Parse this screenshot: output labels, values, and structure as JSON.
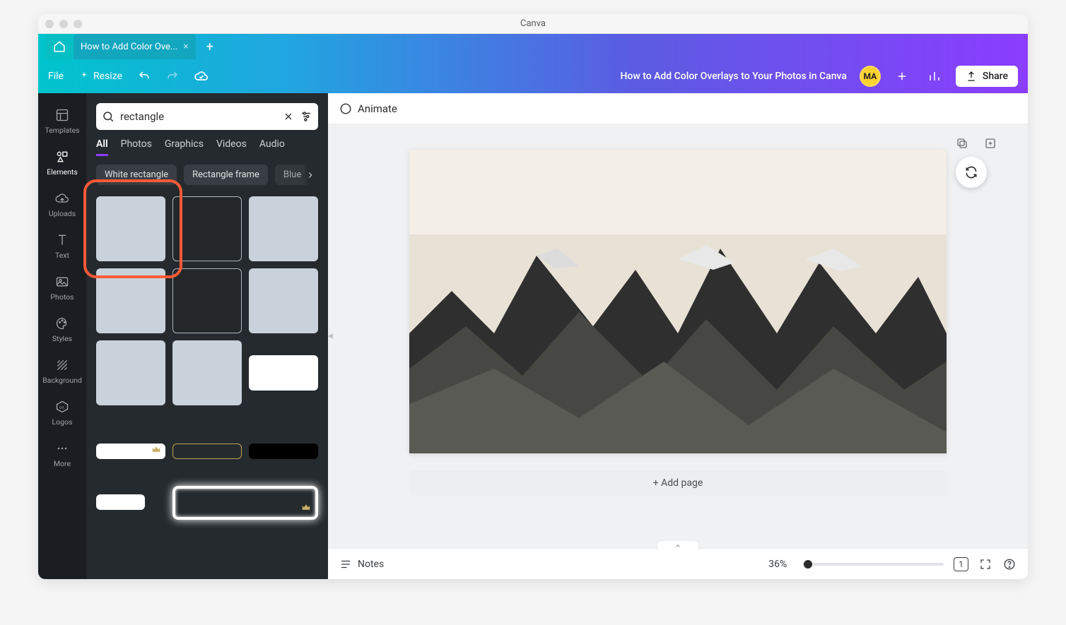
{
  "app_title": "Canva",
  "tabs": {
    "doc_label": "How to Add Color Ove..."
  },
  "toolbar": {
    "file": "File",
    "resize": "Resize",
    "doc_title": "How to Add Color Overlays to Your Photos in Canva",
    "avatar_initials": "MA",
    "share": "Share"
  },
  "rail": {
    "templates": "Templates",
    "elements": "Elements",
    "uploads": "Uploads",
    "text": "Text",
    "photos": "Photos",
    "styles": "Styles",
    "background": "Background",
    "logos": "Logos",
    "more": "More"
  },
  "panel": {
    "search_value": "rectangle",
    "tabs": {
      "all": "All",
      "photos": "Photos",
      "graphics": "Graphics",
      "videos": "Videos",
      "audio": "Audio"
    },
    "chips": {
      "a": "White rectangle",
      "b": "Rectangle frame",
      "c": "Blue"
    }
  },
  "canvas": {
    "animate": "Animate",
    "add_page": "+ Add page"
  },
  "footer": {
    "notes": "Notes",
    "zoom": "36%",
    "page_indicator": "1"
  }
}
